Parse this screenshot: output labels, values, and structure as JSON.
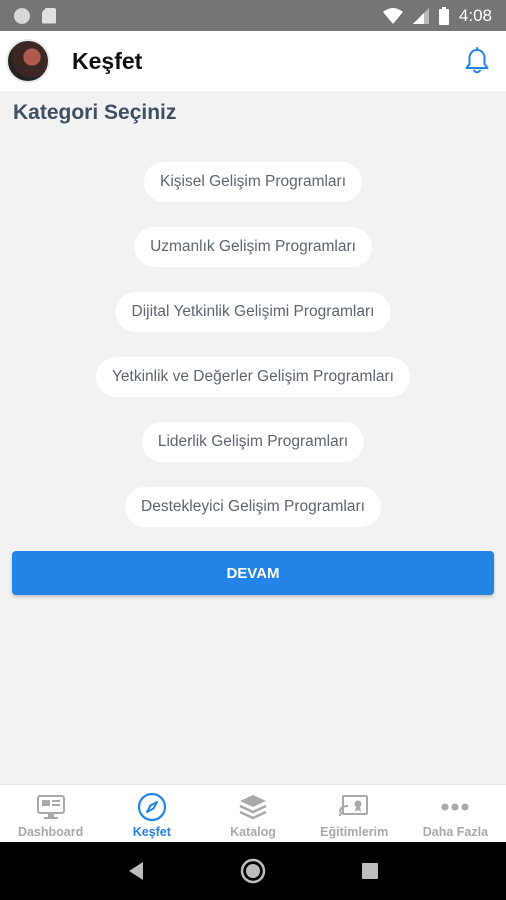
{
  "status_bar": {
    "time": "4:08"
  },
  "app_bar": {
    "title": "Keşfet"
  },
  "section_title": "Kategori Seçiniz",
  "categories": [
    "Kişisel Gelişim Programları",
    "Uzmanlık Gelişim Programları",
    "Dijital Yetkinlik Gelişimi Programları",
    "Yetkinlik ve Değerler Gelişim Programları",
    "Liderlik Gelişim Programları",
    "Destekleyici Gelişim Programları"
  ],
  "continue_button": "DEVAM",
  "bottom_nav": [
    {
      "label": "Dashboard",
      "icon": "monitor-icon",
      "active": false
    },
    {
      "label": "Keşfet",
      "icon": "compass-icon",
      "active": true
    },
    {
      "label": "Katalog",
      "icon": "layers-icon",
      "active": false
    },
    {
      "label": "Eğitimlerim",
      "icon": "cast-certificate-icon",
      "active": false
    },
    {
      "label": "Daha Fazla",
      "icon": "more-dots-icon",
      "active": false
    }
  ],
  "colors": {
    "accent": "#2284e6",
    "title": "#3d4f63",
    "background": "#f2f2f2"
  }
}
